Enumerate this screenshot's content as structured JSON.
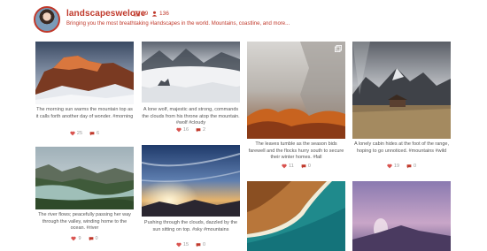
{
  "profile": {
    "username": "landscapeswelove",
    "posts_count": "39",
    "followers_count": "136",
    "bio": "Bringing you the most breathtaking #landscapes in the world. Mountains, coastline, and more..."
  },
  "colors": {
    "accent": "#c0392b",
    "heart": "#d9534f",
    "comment": "#c0392b"
  },
  "posts": [
    {
      "caption": "The morning sun warms the mountain top as it calls forth another day of wonder. #morning",
      "likes": "25",
      "comments": "6"
    },
    {
      "caption": "A lone wolf, majestic and strong, commands the clouds from his throne atop the mountain. #wolf #cloudy",
      "likes": "16",
      "comments": "2"
    },
    {
      "caption": "The leaves tumble as the season bids farewell and the flocks hurry south to secure their winter homes. #fall",
      "likes": "11",
      "comments": "0"
    },
    {
      "caption": "A lonely cabin hides at the foot of the range, hoping to go unnoticed. #mountains #wild",
      "likes": "19",
      "comments": "0"
    },
    {
      "caption": "The river flows; peacefully passing her way through the valley, winding home to the ocean. #river",
      "likes": "9",
      "comments": "0"
    },
    {
      "caption": "Pushing through the clouds, dazzled by the sun sitting on top. #sky #mountains",
      "likes": "15",
      "comments": "0"
    },
    {
      "caption": "",
      "likes": "",
      "comments": ""
    },
    {
      "caption": "",
      "likes": "",
      "comments": ""
    }
  ]
}
